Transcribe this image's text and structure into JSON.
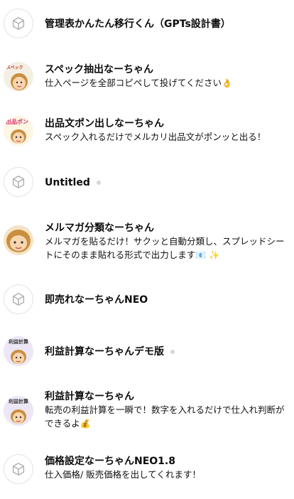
{
  "items": [
    {
      "title": "管理表かんたん移行くん（GPTs設計書）",
      "description": "",
      "avatar": "placeholder",
      "dot": false
    },
    {
      "title": "スペック抽出なーちゃん",
      "description": "仕入ページを全部コピペして投げてください",
      "emoji": "👌",
      "avatar_text": "スペック\nGET",
      "dot": false
    },
    {
      "title": "出品文ポン出しなーちゃん",
      "description": "スペック入れるだけでメルカリ出品文がポンッと出る！",
      "avatar_text": "出品ポン",
      "dot": false
    },
    {
      "title": "Untitled",
      "description": "",
      "avatar": "placeholder",
      "dot": true
    },
    {
      "title": "メルマガ分類なーちゃん",
      "description": "メルマガを貼るだけ！サクッと自動分類し、スプレッドシートにそのまま貼れる形式で出力します",
      "emoji": "📧 ✨",
      "avatar_text": "",
      "dot": false
    },
    {
      "title": "即売れなーちゃんNEO",
      "description": "",
      "avatar": "placeholder",
      "dot": false
    },
    {
      "title": "利益計算なーちゃんデモ版",
      "description": "",
      "avatar_text": "利益計算",
      "dot": true
    },
    {
      "title": "利益計算なーちゃん",
      "description": "転売の利益計算を一瞬で！数字を入れるだけで仕入れ判断ができるよ",
      "emoji": "💰",
      "avatar_text": "利益計算",
      "dot": false
    },
    {
      "title": "価格設定なーちゃんNEO1.8",
      "description": "仕入価格/ 販売価格を出してくれます！",
      "avatar": "placeholder",
      "dot": false
    }
  ],
  "colors": {
    "hair": "#c98f3f",
    "face": "#f7d6b0",
    "placeholder_border": "#e3e3e3",
    "dot": "#d6d6d6"
  }
}
